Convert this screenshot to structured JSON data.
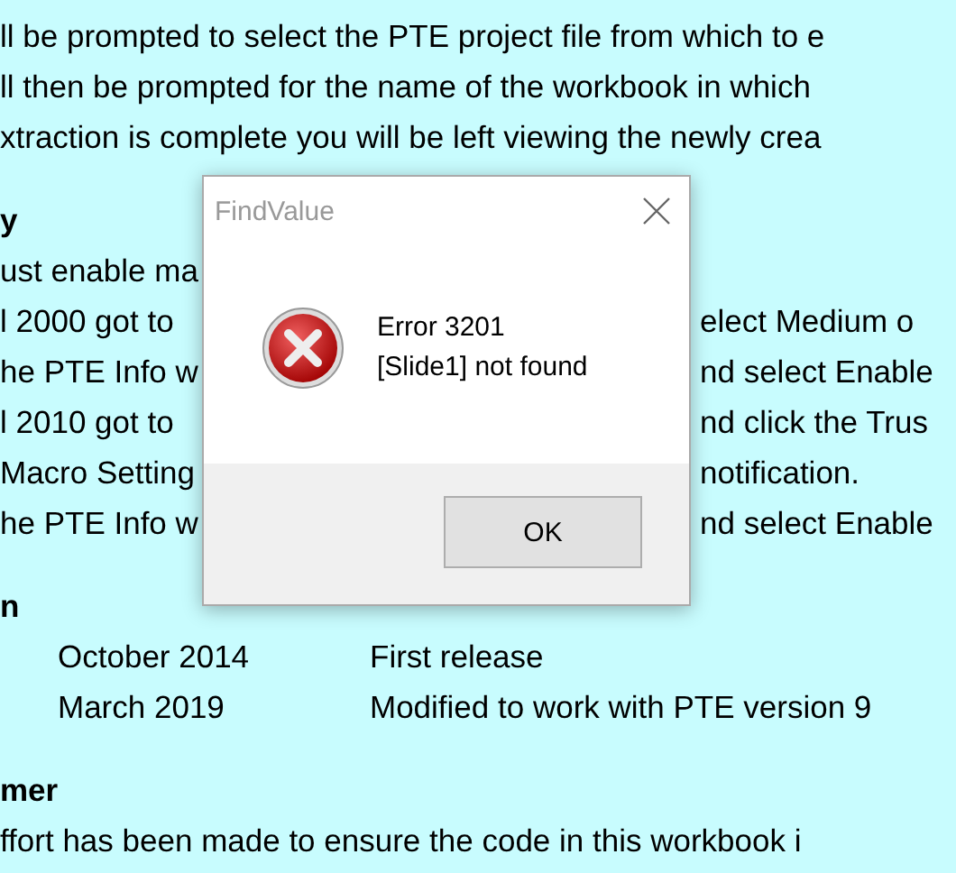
{
  "document": {
    "intro_lines": [
      "ll be prompted to select the PTE project file from which to e",
      "ll then be prompted for the name of the workbook in which",
      "xtraction is complete you will be left viewing the newly crea"
    ],
    "sections": [
      {
        "heading": "y",
        "lines": [
          {
            "left": "ust enable ma"
          },
          {
            "left": "l 2000 got to",
            "right": "elect Medium o"
          },
          {
            "left": "he PTE Info w",
            "right": "nd select Enable"
          },
          {
            "left": "l 2010 got to",
            "right": "nd click the Trus"
          },
          {
            "left": "Macro Setting",
            "right": "notification."
          },
          {
            "left": "he PTE Info w",
            "right": "nd select Enable"
          }
        ]
      },
      {
        "heading": "n",
        "versions": [
          {
            "date": "October 2014",
            "description": "First release"
          },
          {
            "date": "March 2019",
            "description": "Modified to work with PTE version 9"
          }
        ]
      },
      {
        "heading": "mer",
        "lines": [
          {
            "left": "ffort has been made to ensure the code in this workbook i"
          }
        ]
      }
    ]
  },
  "dialog": {
    "title": "FindValue",
    "message_lines": [
      "Error 3201",
      "[Slide1] not found"
    ],
    "button": "OK"
  }
}
